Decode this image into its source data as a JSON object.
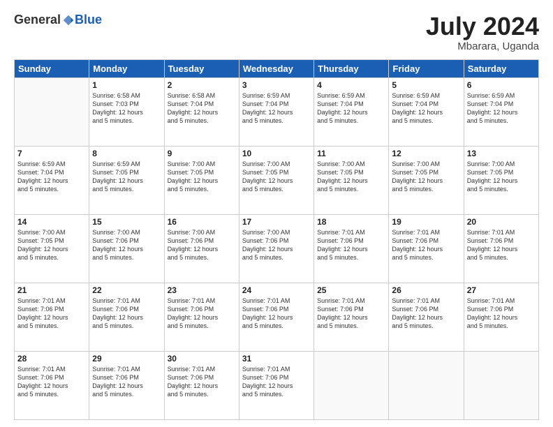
{
  "header": {
    "logo_general": "General",
    "logo_blue": "Blue",
    "month": "July 2024",
    "location": "Mbarara, Uganda"
  },
  "days_of_week": [
    "Sunday",
    "Monday",
    "Tuesday",
    "Wednesday",
    "Thursday",
    "Friday",
    "Saturday"
  ],
  "weeks": [
    [
      {
        "day": "",
        "info": ""
      },
      {
        "day": "1",
        "info": "Sunrise: 6:58 AM\nSunset: 7:03 PM\nDaylight: 12 hours\nand 5 minutes."
      },
      {
        "day": "2",
        "info": "Sunrise: 6:58 AM\nSunset: 7:04 PM\nDaylight: 12 hours\nand 5 minutes."
      },
      {
        "day": "3",
        "info": "Sunrise: 6:59 AM\nSunset: 7:04 PM\nDaylight: 12 hours\nand 5 minutes."
      },
      {
        "day": "4",
        "info": "Sunrise: 6:59 AM\nSunset: 7:04 PM\nDaylight: 12 hours\nand 5 minutes."
      },
      {
        "day": "5",
        "info": "Sunrise: 6:59 AM\nSunset: 7:04 PM\nDaylight: 12 hours\nand 5 minutes."
      },
      {
        "day": "6",
        "info": "Sunrise: 6:59 AM\nSunset: 7:04 PM\nDaylight: 12 hours\nand 5 minutes."
      }
    ],
    [
      {
        "day": "7",
        "info": "Sunrise: 6:59 AM\nSunset: 7:04 PM\nDaylight: 12 hours\nand 5 minutes."
      },
      {
        "day": "8",
        "info": "Sunrise: 6:59 AM\nSunset: 7:05 PM\nDaylight: 12 hours\nand 5 minutes."
      },
      {
        "day": "9",
        "info": "Sunrise: 7:00 AM\nSunset: 7:05 PM\nDaylight: 12 hours\nand 5 minutes."
      },
      {
        "day": "10",
        "info": "Sunrise: 7:00 AM\nSunset: 7:05 PM\nDaylight: 12 hours\nand 5 minutes."
      },
      {
        "day": "11",
        "info": "Sunrise: 7:00 AM\nSunset: 7:05 PM\nDaylight: 12 hours\nand 5 minutes."
      },
      {
        "day": "12",
        "info": "Sunrise: 7:00 AM\nSunset: 7:05 PM\nDaylight: 12 hours\nand 5 minutes."
      },
      {
        "day": "13",
        "info": "Sunrise: 7:00 AM\nSunset: 7:05 PM\nDaylight: 12 hours\nand 5 minutes."
      }
    ],
    [
      {
        "day": "14",
        "info": "Sunrise: 7:00 AM\nSunset: 7:05 PM\nDaylight: 12 hours\nand 5 minutes."
      },
      {
        "day": "15",
        "info": "Sunrise: 7:00 AM\nSunset: 7:06 PM\nDaylight: 12 hours\nand 5 minutes."
      },
      {
        "day": "16",
        "info": "Sunrise: 7:00 AM\nSunset: 7:06 PM\nDaylight: 12 hours\nand 5 minutes."
      },
      {
        "day": "17",
        "info": "Sunrise: 7:00 AM\nSunset: 7:06 PM\nDaylight: 12 hours\nand 5 minutes."
      },
      {
        "day": "18",
        "info": "Sunrise: 7:01 AM\nSunset: 7:06 PM\nDaylight: 12 hours\nand 5 minutes."
      },
      {
        "day": "19",
        "info": "Sunrise: 7:01 AM\nSunset: 7:06 PM\nDaylight: 12 hours\nand 5 minutes."
      },
      {
        "day": "20",
        "info": "Sunrise: 7:01 AM\nSunset: 7:06 PM\nDaylight: 12 hours\nand 5 minutes."
      }
    ],
    [
      {
        "day": "21",
        "info": "Sunrise: 7:01 AM\nSunset: 7:06 PM\nDaylight: 12 hours\nand 5 minutes."
      },
      {
        "day": "22",
        "info": "Sunrise: 7:01 AM\nSunset: 7:06 PM\nDaylight: 12 hours\nand 5 minutes."
      },
      {
        "day": "23",
        "info": "Sunrise: 7:01 AM\nSunset: 7:06 PM\nDaylight: 12 hours\nand 5 minutes."
      },
      {
        "day": "24",
        "info": "Sunrise: 7:01 AM\nSunset: 7:06 PM\nDaylight: 12 hours\nand 5 minutes."
      },
      {
        "day": "25",
        "info": "Sunrise: 7:01 AM\nSunset: 7:06 PM\nDaylight: 12 hours\nand 5 minutes."
      },
      {
        "day": "26",
        "info": "Sunrise: 7:01 AM\nSunset: 7:06 PM\nDaylight: 12 hours\nand 5 minutes."
      },
      {
        "day": "27",
        "info": "Sunrise: 7:01 AM\nSunset: 7:06 PM\nDaylight: 12 hours\nand 5 minutes."
      }
    ],
    [
      {
        "day": "28",
        "info": "Sunrise: 7:01 AM\nSunset: 7:06 PM\nDaylight: 12 hours\nand 5 minutes."
      },
      {
        "day": "29",
        "info": "Sunrise: 7:01 AM\nSunset: 7:06 PM\nDaylight: 12 hours\nand 5 minutes."
      },
      {
        "day": "30",
        "info": "Sunrise: 7:01 AM\nSunset: 7:06 PM\nDaylight: 12 hours\nand 5 minutes."
      },
      {
        "day": "31",
        "info": "Sunrise: 7:01 AM\nSunset: 7:06 PM\nDaylight: 12 hours\nand 5 minutes."
      },
      {
        "day": "",
        "info": ""
      },
      {
        "day": "",
        "info": ""
      },
      {
        "day": "",
        "info": ""
      }
    ]
  ]
}
